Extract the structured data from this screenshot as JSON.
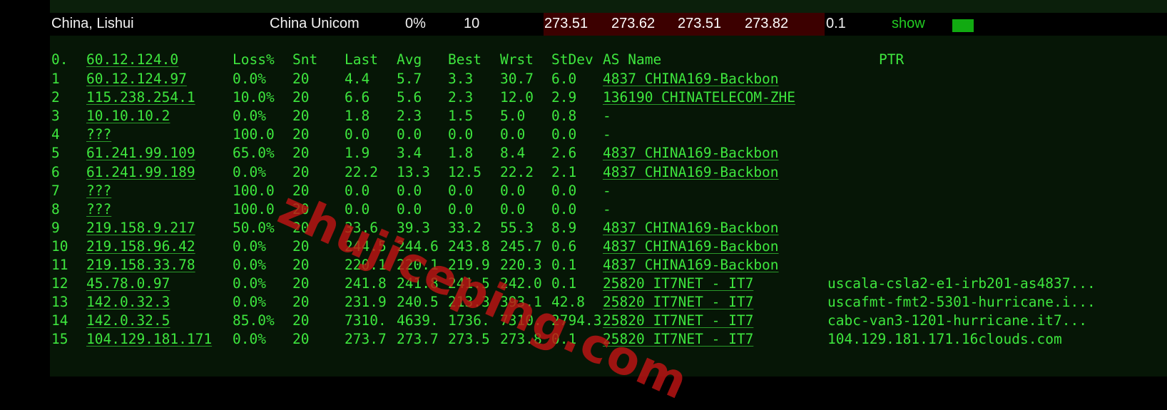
{
  "summary": {
    "location": "China, Lishui",
    "isp": "China Unicom",
    "loss": "0%",
    "sent": "10",
    "last": "273.51",
    "avg": "273.62",
    "best": "273.51",
    "worst": "273.82",
    "stdev": "0.1",
    "show_label": "show",
    "bar_color": "#11aa11"
  },
  "mtr": {
    "headers": {
      "host": "0.",
      "host_ip": "60.12.124.0",
      "loss": "Loss%",
      "snt": "Snt",
      "last": "Last",
      "avg": "Avg",
      "best": "Best",
      "wrst": "Wrst",
      "stdev": "StDev",
      "as_name": "AS Name",
      "ptr": "PTR"
    },
    "rows": [
      {
        "hop": "1",
        "ip": "60.12.124.97",
        "loss": "0.0%",
        "snt": "20",
        "last": "4.4",
        "avg": "5.7",
        "best": "3.3",
        "wrst": "30.7",
        "stdev": "6.0",
        "as": "4837  CHINA169-Backbon",
        "ptr": ""
      },
      {
        "hop": "2",
        "ip": "115.238.254.1",
        "loss": "10.0%",
        "snt": "20",
        "last": "6.6",
        "avg": "5.6",
        "best": "2.3",
        "wrst": "12.0",
        "stdev": "2.9",
        "as": "136190 CHINATELECOM-ZHE",
        "ptr": ""
      },
      {
        "hop": "3",
        "ip": "10.10.10.2",
        "loss": "0.0%",
        "snt": "20",
        "last": "1.8",
        "avg": "2.3",
        "best": "1.5",
        "wrst": "5.0",
        "stdev": "0.8",
        "as": "-",
        "ptr": ""
      },
      {
        "hop": "4",
        "ip": "???",
        "loss": "100.0",
        "snt": "20",
        "last": "0.0",
        "avg": "0.0",
        "best": "0.0",
        "wrst": "0.0",
        "stdev": "0.0",
        "as": "-",
        "ptr": ""
      },
      {
        "hop": "5",
        "ip": "61.241.99.109",
        "loss": "65.0%",
        "snt": "20",
        "last": "1.9",
        "avg": "3.4",
        "best": "1.8",
        "wrst": "8.4",
        "stdev": "2.6",
        "as": "4837  CHINA169-Backbon",
        "ptr": ""
      },
      {
        "hop": "6",
        "ip": "61.241.99.189",
        "loss": "0.0%",
        "snt": "20",
        "last": "22.2",
        "avg": "13.3",
        "best": "12.5",
        "wrst": "22.2",
        "stdev": "2.1",
        "as": "4837  CHINA169-Backbon",
        "ptr": ""
      },
      {
        "hop": "7",
        "ip": "???",
        "loss": "100.0",
        "snt": "20",
        "last": "0.0",
        "avg": "0.0",
        "best": "0.0",
        "wrst": "0.0",
        "stdev": "0.0",
        "as": "-",
        "ptr": ""
      },
      {
        "hop": "8",
        "ip": "???",
        "loss": "100.0",
        "snt": "20",
        "last": "0.0",
        "avg": "0.0",
        "best": "0.0",
        "wrst": "0.0",
        "stdev": "0.0",
        "as": "-",
        "ptr": ""
      },
      {
        "hop": "9",
        "ip": "219.158.9.217",
        "loss": "50.0%",
        "snt": "20",
        "last": "33.6",
        "avg": "39.3",
        "best": "33.2",
        "wrst": "55.3",
        "stdev": "8.9",
        "as": "4837  CHINA169-Backbon",
        "ptr": ""
      },
      {
        "hop": "10",
        "ip": "219.158.96.42",
        "loss": "0.0%",
        "snt": "20",
        "last": "244.5",
        "avg": "244.6",
        "best": "243.8",
        "wrst": "245.7",
        "stdev": "0.6",
        "as": "4837  CHINA169-Backbon",
        "ptr": ""
      },
      {
        "hop": "11",
        "ip": "219.158.33.78",
        "loss": "0.0%",
        "snt": "20",
        "last": "220.1",
        "avg": "220.1",
        "best": "219.9",
        "wrst": "220.3",
        "stdev": "0.1",
        "as": "4837  CHINA169-Backbon",
        "ptr": ""
      },
      {
        "hop": "12",
        "ip": "45.78.0.97",
        "loss": "0.0%",
        "snt": "20",
        "last": "241.8",
        "avg": "241.8",
        "best": "241.5",
        "wrst": "242.0",
        "stdev": "0.1",
        "as": "25820 IT7NET - IT7",
        "ptr": "uscala-csla2-e1-irb201-as4837..."
      },
      {
        "hop": "13",
        "ip": "142.0.32.3",
        "loss": "0.0%",
        "snt": "20",
        "last": "231.9",
        "avg": "240.5",
        "best": "213.3",
        "wrst": "393.1",
        "stdev": "42.8",
        "as": "25820 IT7NET - IT7",
        "ptr": "uscafmt-fmt2-5301-hurricane.i..."
      },
      {
        "hop": "14",
        "ip": "142.0.32.5",
        "loss": "85.0%",
        "snt": "20",
        "last": "7310.",
        "avg": "4639.",
        "best": "1736.",
        "wrst": "7310.",
        "stdev": "2794.3",
        "as": "25820 IT7NET - IT7",
        "ptr": "cabc-van3-1201-hurricane.it7..."
      },
      {
        "hop": "15",
        "ip": "104.129.181.171",
        "loss": "0.0%",
        "snt": "20",
        "last": "273.7",
        "avg": "273.7",
        "best": "273.5",
        "wrst": "273.8",
        "stdev": "0.1",
        "as": "25820 IT7NET - IT7",
        "ptr": "104.129.181.171.16clouds.com"
      }
    ]
  },
  "watermark": "zhujiceping.com",
  "colors": {
    "terminal_green": "#3ee63e",
    "latency_bg": "#3c0000",
    "watermark": "#be1414"
  }
}
